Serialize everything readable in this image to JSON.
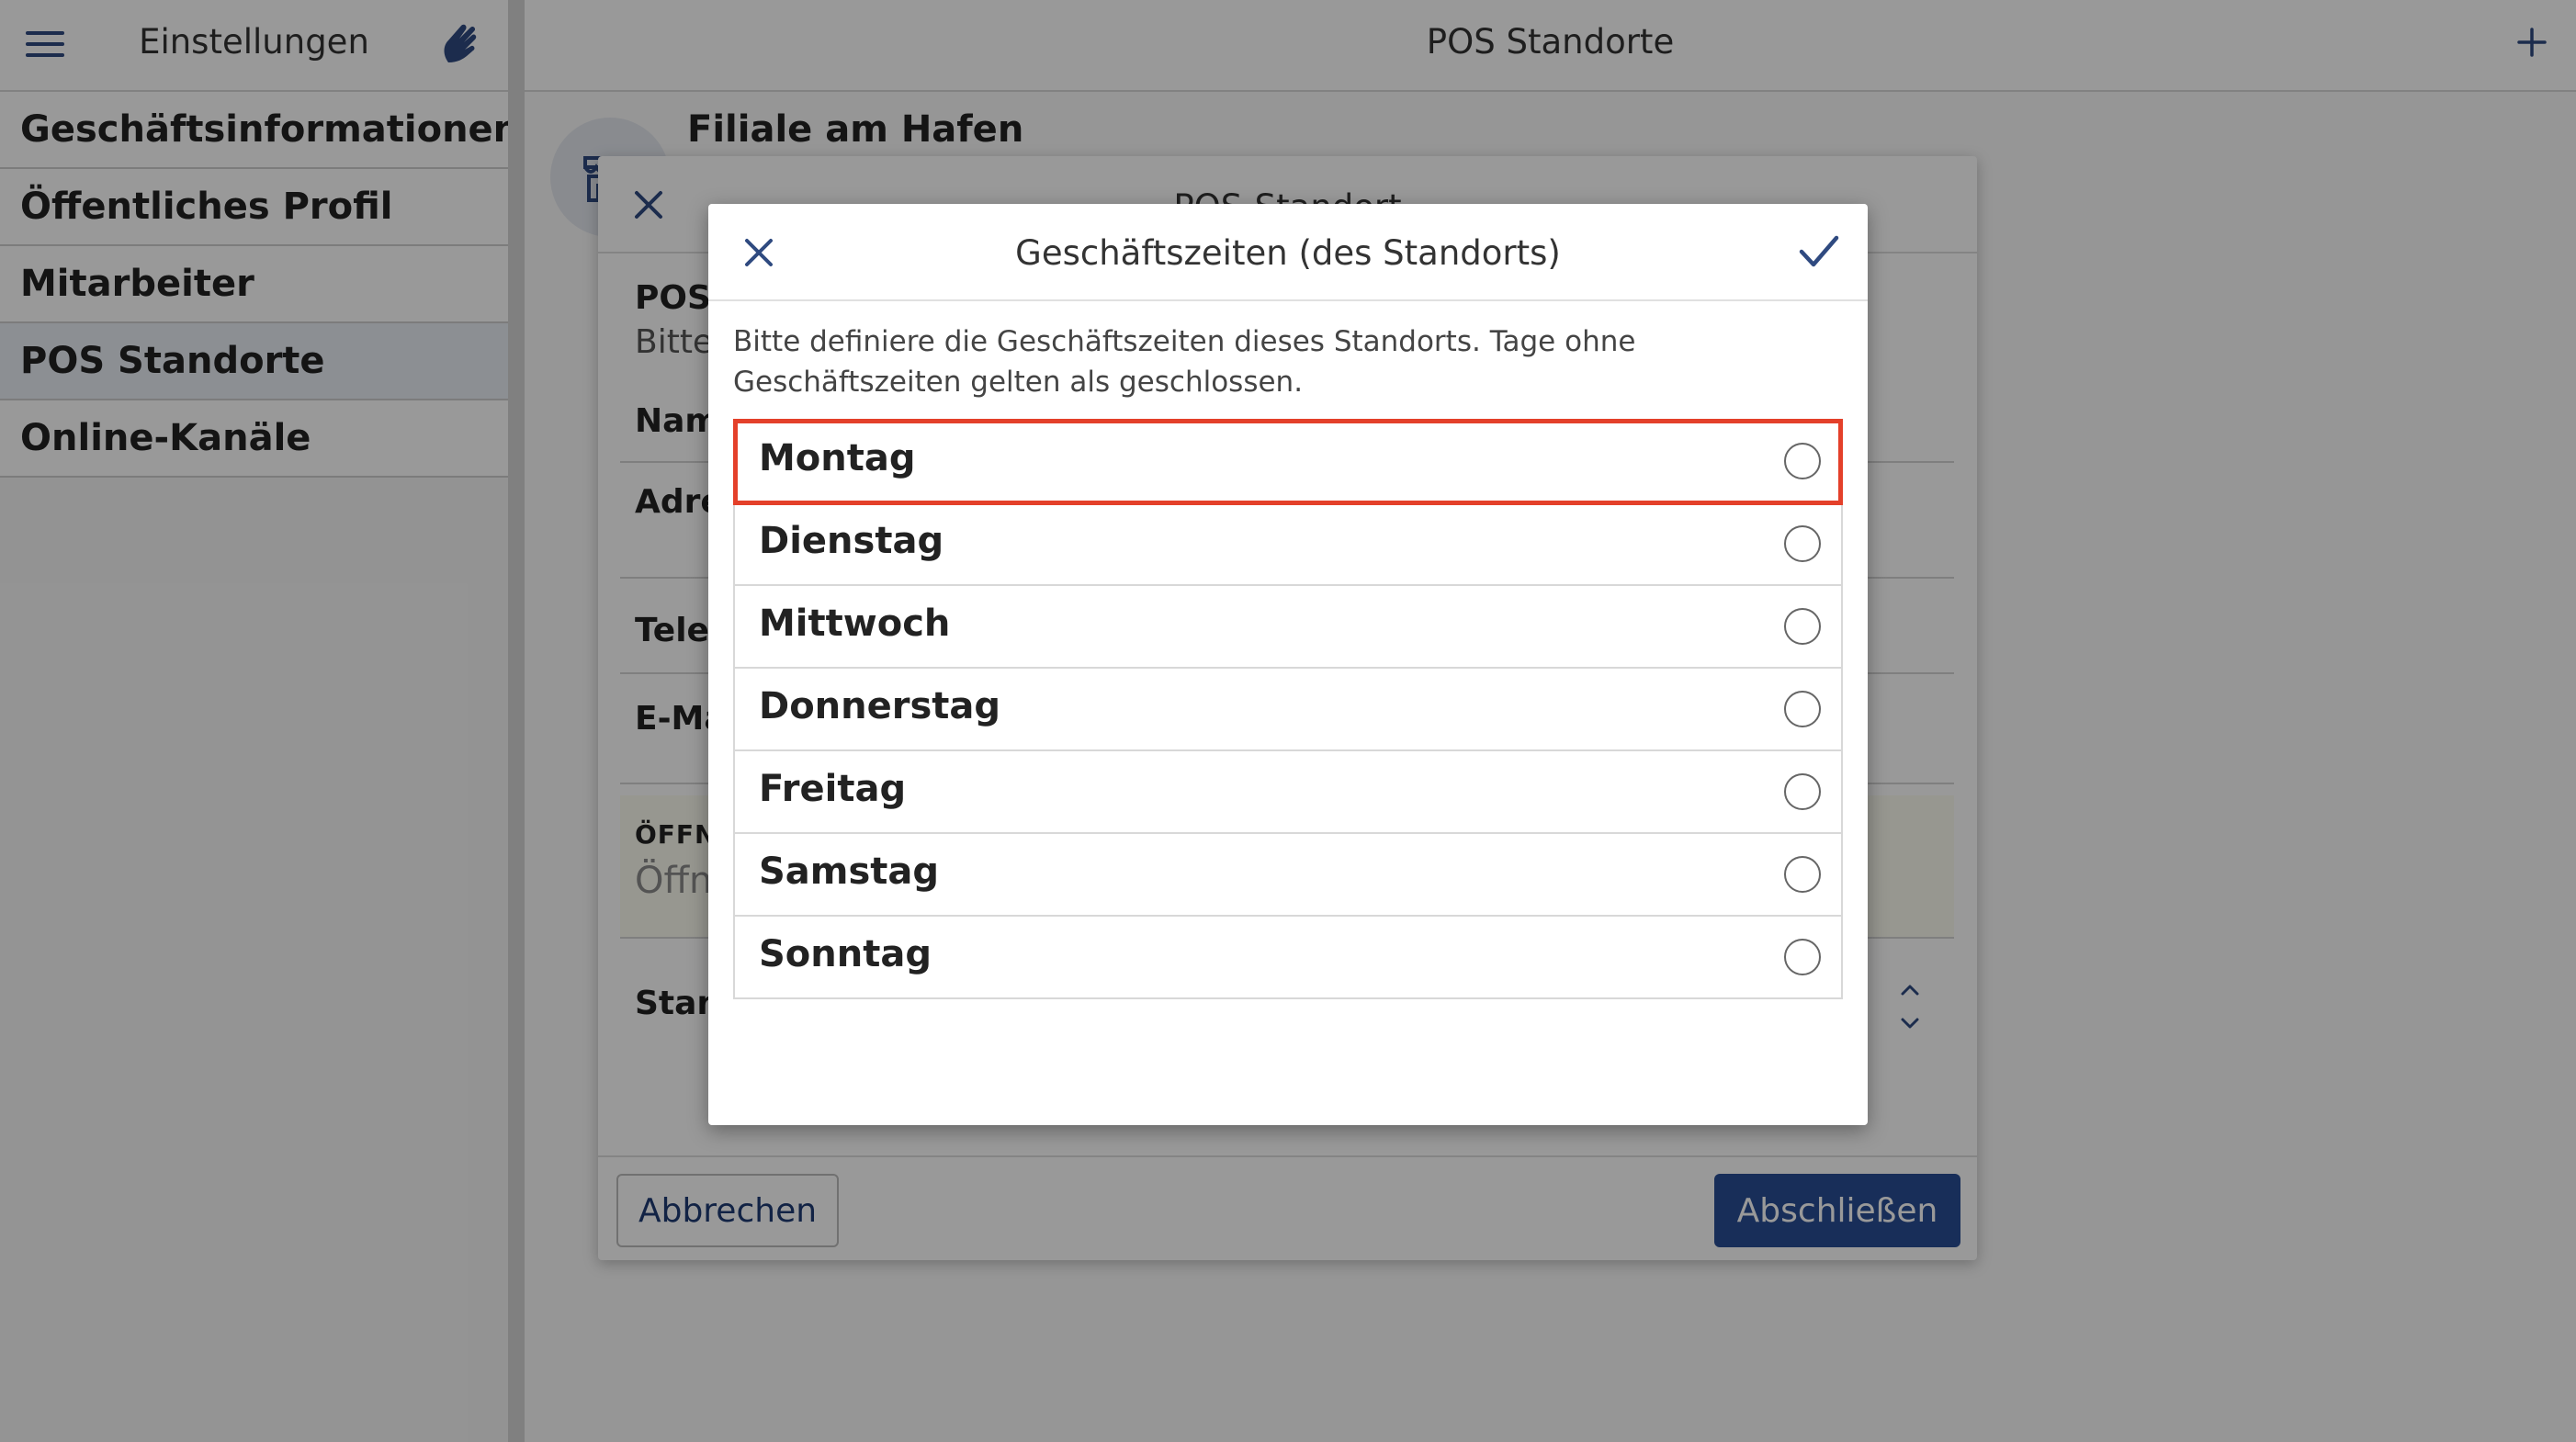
{
  "sidebar": {
    "title": "Einstellungen",
    "menu_icon": "hamburger-menu-icon",
    "brand_icon": "hand-logo-icon",
    "items": [
      {
        "label": "Geschäftsinformationen",
        "active": false
      },
      {
        "label": "Öffentliches Profil",
        "active": false
      },
      {
        "label": "Mitarbeiter",
        "active": false
      },
      {
        "label": "POS Standorte",
        "active": true
      },
      {
        "label": "Online-Kanäle",
        "active": false
      }
    ]
  },
  "main": {
    "title": "POS Standorte",
    "add_icon": "plus-icon",
    "store": {
      "name": "Filiale am Hafen",
      "icon": "store-icon"
    }
  },
  "pos_dialog": {
    "title": "POS-Standort",
    "close_icon": "close-icon",
    "section_label": "POS-S",
    "section_sub": "Bitte",
    "fields": {
      "name_label": "Nam",
      "address_label": "Adre",
      "phone_label": "Telef",
      "email_label": "E-Ma"
    },
    "hours": {
      "label": "ÖFFNU",
      "sub": "Öffnu"
    },
    "status_label": "Stan",
    "cancel_label": "Abbrechen",
    "finish_label": "Abschließen"
  },
  "hours_dialog": {
    "title": "Geschäftszeiten (des Standorts)",
    "close_icon": "close-icon",
    "confirm_icon": "checkmark-icon",
    "info": "Bitte definiere die Geschäftszeiten dieses Standorts. Tage ohne Geschäftszeiten gelten als geschlossen.",
    "days": [
      {
        "name": "Montag",
        "selected": false,
        "highlighted": true
      },
      {
        "name": "Dienstag",
        "selected": false,
        "highlighted": false
      },
      {
        "name": "Mittwoch",
        "selected": false,
        "highlighted": false
      },
      {
        "name": "Donnerstag",
        "selected": false,
        "highlighted": false
      },
      {
        "name": "Freitag",
        "selected": false,
        "highlighted": false
      },
      {
        "name": "Samstag",
        "selected": false,
        "highlighted": false
      },
      {
        "name": "Sonntag",
        "selected": false,
        "highlighted": false
      }
    ],
    "colors": {
      "highlight": "#e4402a",
      "accent": "#284d94"
    }
  }
}
